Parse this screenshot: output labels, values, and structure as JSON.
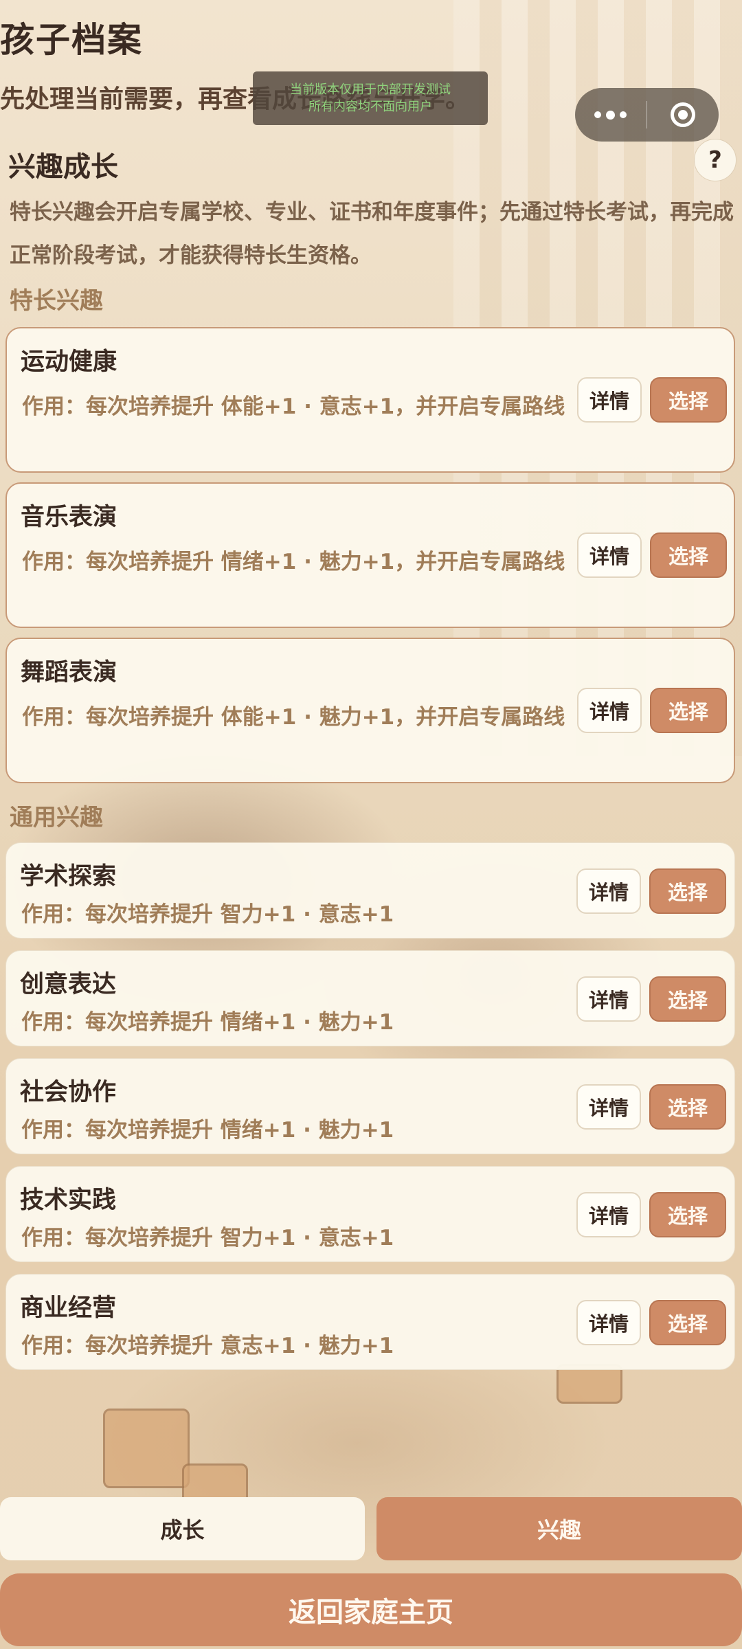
{
  "page": {
    "title": "孩子档案",
    "subtitle": "先处理当前需要，再查看成长路线与升学。"
  },
  "dev_toast": {
    "line1": "当前版本仅用于内部开发测试",
    "line2": "所有内容均不面向用户"
  },
  "section": {
    "title": "兴趣成长",
    "help_label": "?",
    "description": "特长兴趣会开启专属学校、专业、证书和年度事件；先通过特长考试，再完成正常阶段考试，才能获得特长生资格。"
  },
  "special_group": {
    "label": "特长兴趣",
    "items": [
      {
        "name": "运动健康",
        "effect": "作用：每次培养提升 体能+1 · 意志+1，并开启专属路线"
      },
      {
        "name": "音乐表演",
        "effect": "作用：每次培养提升 情绪+1 · 魅力+1，并开启专属路线"
      },
      {
        "name": "舞蹈表演",
        "effect": "作用：每次培养提升 体能+1 · 魅力+1，并开启专属路线"
      }
    ]
  },
  "general_group": {
    "label": "通用兴趣",
    "items": [
      {
        "name": "学术探索",
        "effect": "作用：每次培养提升 智力+1 · 意志+1"
      },
      {
        "name": "创意表达",
        "effect": "作用：每次培养提升 情绪+1 · 魅力+1"
      },
      {
        "name": "社会协作",
        "effect": "作用：每次培养提升 情绪+1 · 魅力+1"
      },
      {
        "name": "技术实践",
        "effect": "作用：每次培养提升 智力+1 · 意志+1"
      },
      {
        "name": "商业经营",
        "effect": "作用：每次培养提升 意志+1 · 魅力+1"
      }
    ]
  },
  "buttons": {
    "detail": "详情",
    "select": "选择"
  },
  "tabs": [
    {
      "label": "成长",
      "active": false
    },
    {
      "label": "兴趣",
      "active": true
    }
  ],
  "footer": {
    "home_button": "返回家庭主页"
  },
  "colors": {
    "accent": "#cf8b66",
    "card_bg": "#fcf8ec",
    "label_brown": "#a07d58"
  }
}
